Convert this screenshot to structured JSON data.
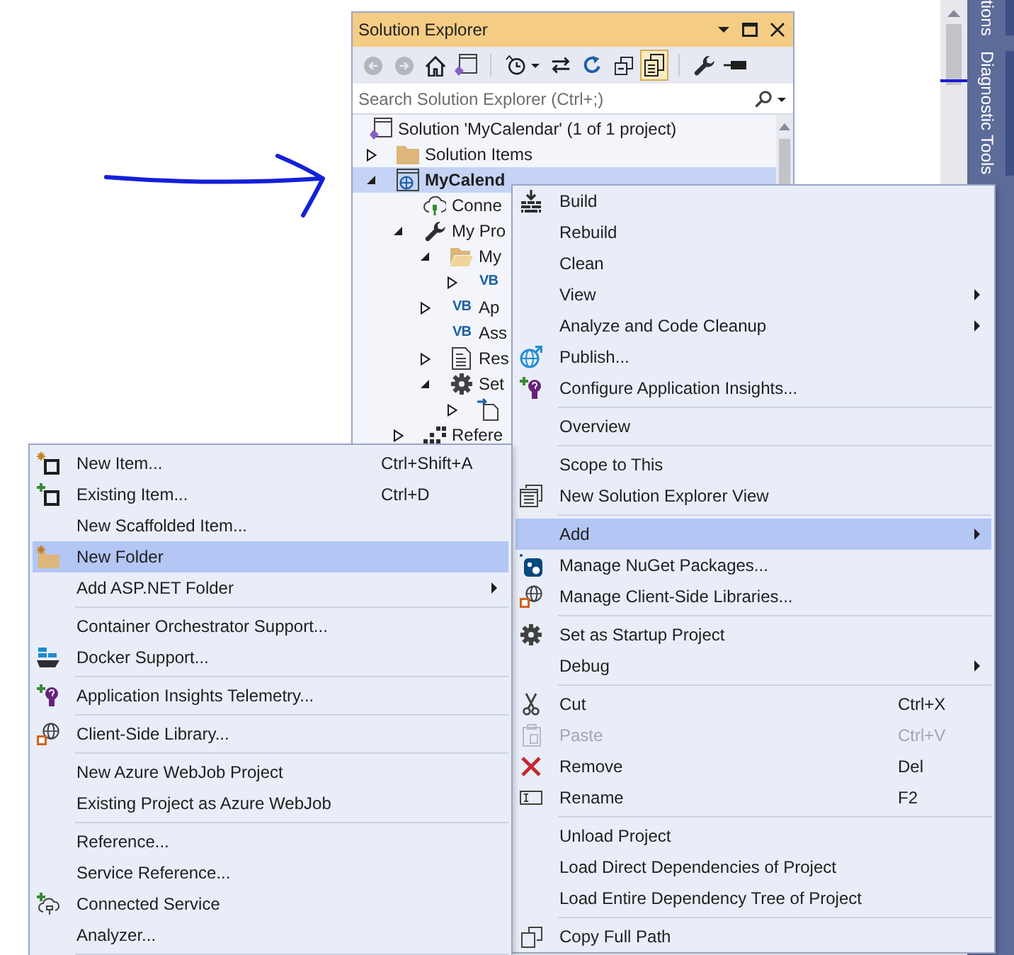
{
  "solution_explorer": {
    "title": "Solution Explorer",
    "toolbar": [
      {
        "kind": "back",
        "disabled": true,
        "selected": false
      },
      {
        "kind": "forward",
        "disabled": true,
        "selected": false
      },
      {
        "kind": "home",
        "disabled": false,
        "selected": false
      },
      {
        "kind": "switch",
        "disabled": false,
        "selected": false
      },
      {
        "kind": "separator"
      },
      {
        "kind": "history",
        "disabled": false,
        "selected": false
      },
      {
        "kind": "sync",
        "disabled": false,
        "selected": false
      },
      {
        "kind": "refresh",
        "disabled": false,
        "selected": false
      },
      {
        "kind": "collapse",
        "disabled": false,
        "selected": false
      },
      {
        "kind": "showall",
        "disabled": false,
        "selected": true
      },
      {
        "kind": "separator"
      },
      {
        "kind": "properties",
        "disabled": false,
        "selected": false
      },
      {
        "kind": "preview",
        "disabled": false,
        "selected": false
      }
    ],
    "search": {
      "placeholder": "Search Solution Explorer (Ctrl+;)"
    },
    "tree": [
      {
        "kind": "solution",
        "label": "Solution 'MyCalendar' (1 of 1 project)",
        "selected": false,
        "startup": false,
        "children": [
          {
            "kind": "folder",
            "label": "Solution Items",
            "expanded": false,
            "selected": false,
            "startup": false
          },
          {
            "kind": "project",
            "label": "MyCalend",
            "expanded": true,
            "selected": true,
            "startup": true,
            "children": [
              {
                "kind": "service",
                "label": "Conne",
                "selected": false,
                "startup": false
              },
              {
                "kind": "properties",
                "label": "My Pro",
                "expanded": true,
                "selected": false,
                "startup": false,
                "children": [
                  {
                    "kind": "openfolder",
                    "label": "My",
                    "expanded": true,
                    "selected": false,
                    "startup": false,
                    "children": [
                      {
                        "kind": "vbfile",
                        "badge": "VB",
                        "expanded": false,
                        "selected": false
                      }
                    ]
                  },
                  {
                    "kind": "vbfile",
                    "badge": "VB",
                    "label": "Ap",
                    "expanded": false,
                    "selected": false,
                    "startup": false
                  },
                  {
                    "kind": "vbfile",
                    "badge": "VB",
                    "label": "Ass",
                    "selected": false,
                    "startup": false
                  },
                  {
                    "kind": "resources",
                    "label": "Res",
                    "expanded": false,
                    "selected": false,
                    "startup": false
                  },
                  {
                    "kind": "settings",
                    "label": "Set",
                    "expanded": true,
                    "selected": false,
                    "startup": false,
                    "children": [
                      {
                        "kind": "settingsfile",
                        "expanded": false,
                        "selected": false
                      }
                    ]
                  }
                ]
              },
              {
                "kind": "references",
                "label": "Refere",
                "expanded": false,
                "selected": false,
                "startup": false
              }
            ]
          }
        ]
      }
    ]
  },
  "context_menu": {
    "items": [
      {
        "kind": "build",
        "label": "Build",
        "submenu": false,
        "disabled": false,
        "selected": false
      },
      {
        "kind": "plain",
        "label": "Rebuild",
        "submenu": false,
        "disabled": false,
        "selected": false
      },
      {
        "kind": "plain",
        "label": "Clean",
        "submenu": false,
        "disabled": false,
        "selected": false
      },
      {
        "kind": "plain",
        "label": "View",
        "submenu": true,
        "disabled": false,
        "selected": false
      },
      {
        "kind": "plain",
        "label": "Analyze and Code Cleanup",
        "submenu": true,
        "disabled": false,
        "selected": false
      },
      {
        "kind": "publish",
        "label": "Publish...",
        "submenu": false,
        "disabled": false,
        "selected": false
      },
      {
        "kind": "insights",
        "label": "Configure Application Insights...",
        "submenu": false,
        "disabled": false,
        "selected": false
      },
      {
        "kind": "separator"
      },
      {
        "kind": "plain",
        "label": "Overview",
        "submenu": false,
        "disabled": false,
        "selected": false
      },
      {
        "kind": "separator"
      },
      {
        "kind": "plain",
        "label": "Scope to This",
        "submenu": false,
        "disabled": false,
        "selected": false
      },
      {
        "kind": "explorerview",
        "label": "New Solution Explorer View",
        "submenu": false,
        "disabled": false,
        "selected": false
      },
      {
        "kind": "separator"
      },
      {
        "kind": "plain",
        "label": "Add",
        "submenu": true,
        "disabled": false,
        "selected": true
      },
      {
        "kind": "nuget",
        "label": "Manage NuGet Packages...",
        "submenu": false,
        "disabled": false,
        "selected": false
      },
      {
        "kind": "library",
        "label": "Manage Client-Side Libraries...",
        "submenu": false,
        "disabled": false,
        "selected": false
      },
      {
        "kind": "separator"
      },
      {
        "kind": "gear",
        "label": "Set as Startup Project",
        "submenu": false,
        "disabled": false,
        "selected": false
      },
      {
        "kind": "plain",
        "label": "Debug",
        "submenu": true,
        "disabled": false,
        "selected": false
      },
      {
        "kind": "separator"
      },
      {
        "kind": "cut",
        "label": "Cut",
        "shortcut": "Ctrl+X",
        "submenu": false,
        "disabled": false,
        "selected": false
      },
      {
        "kind": "paste",
        "label": "Paste",
        "shortcut": "Ctrl+V",
        "submenu": false,
        "disabled": true,
        "selected": false
      },
      {
        "kind": "remove",
        "label": "Remove",
        "shortcut": "Del",
        "submenu": false,
        "disabled": false,
        "selected": false
      },
      {
        "kind": "rename",
        "label": "Rename",
        "shortcut": "F2",
        "submenu": false,
        "disabled": false,
        "selected": false
      },
      {
        "kind": "separator"
      },
      {
        "kind": "plain",
        "label": "Unload Project",
        "submenu": false,
        "disabled": false,
        "selected": false
      },
      {
        "kind": "plain",
        "label": "Load Direct Dependencies of Project",
        "submenu": false,
        "disabled": false,
        "selected": false
      },
      {
        "kind": "plain",
        "label": "Load Entire Dependency Tree of Project",
        "submenu": false,
        "disabled": false,
        "selected": false
      },
      {
        "kind": "separator"
      },
      {
        "kind": "copy",
        "label": "Copy Full Path",
        "submenu": false,
        "disabled": false,
        "selected": false
      }
    ]
  },
  "add_submenu": {
    "items": [
      {
        "kind": "newitem",
        "label": "New Item...",
        "shortcut": "Ctrl+Shift+A",
        "submenu": false,
        "disabled": false,
        "selected": false
      },
      {
        "kind": "existingitem",
        "label": "Existing Item...",
        "shortcut": "Ctrl+D",
        "submenu": false,
        "disabled": false,
        "selected": false
      },
      {
        "kind": "plain",
        "label": "New Scaffolded Item...",
        "submenu": false,
        "disabled": false,
        "selected": false
      },
      {
        "kind": "newfolder",
        "label": "New Folder",
        "submenu": false,
        "disabled": false,
        "selected": true
      },
      {
        "kind": "plain",
        "label": "Add ASP.NET Folder",
        "submenu": true,
        "disabled": false,
        "selected": false
      },
      {
        "kind": "separator"
      },
      {
        "kind": "plain",
        "label": "Container Orchestrator Support...",
        "submenu": false,
        "disabled": false,
        "selected": false
      },
      {
        "kind": "docker",
        "label": "Docker Support...",
        "submenu": false,
        "disabled": false,
        "selected": false
      },
      {
        "kind": "separator"
      },
      {
        "kind": "insights",
        "label": "Application Insights Telemetry...",
        "submenu": false,
        "disabled": false,
        "selected": false
      },
      {
        "kind": "separator"
      },
      {
        "kind": "library",
        "label": "Client-Side Library...",
        "submenu": false,
        "disabled": false,
        "selected": false
      },
      {
        "kind": "separator"
      },
      {
        "kind": "plain",
        "label": "New Azure WebJob Project",
        "submenu": false,
        "disabled": false,
        "selected": false
      },
      {
        "kind": "plain",
        "label": "Existing Project as Azure WebJob",
        "submenu": false,
        "disabled": false,
        "selected": false
      },
      {
        "kind": "separator"
      },
      {
        "kind": "plain",
        "label": "Reference...",
        "submenu": false,
        "disabled": false,
        "selected": false
      },
      {
        "kind": "plain",
        "label": "Service Reference...",
        "submenu": false,
        "disabled": false,
        "selected": false
      },
      {
        "kind": "connected",
        "label": "Connected Service",
        "submenu": false,
        "disabled": false,
        "selected": false
      },
      {
        "kind": "plain",
        "label": "Analyzer...",
        "submenu": false,
        "disabled": false,
        "selected": false
      },
      {
        "kind": "separator"
      }
    ]
  },
  "side_panel": {
    "tabs": [
      {
        "label": "tions"
      },
      {
        "label": "Diagnostic Tools"
      }
    ]
  }
}
